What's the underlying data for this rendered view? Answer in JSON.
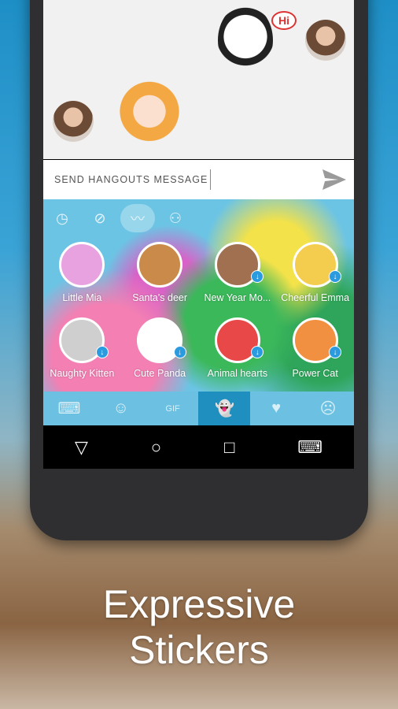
{
  "chat": {
    "input_placeholder": "SEND HANGOUTS MESSAGE",
    "sticker_bubble": "Hi"
  },
  "keyboard": {
    "categories": [
      {
        "icon": "clock-icon"
      },
      {
        "icon": "compass-icon"
      },
      {
        "icon": "trending-icon",
        "active": true
      },
      {
        "icon": "person-icon"
      }
    ],
    "stickers": [
      {
        "label": "Little Mia",
        "color": "#e9a2e0",
        "download": false
      },
      {
        "label": "Santa's deer",
        "color": "#c98a4a",
        "download": false
      },
      {
        "label": "New Year Mo...",
        "color": "#a07050",
        "download": true
      },
      {
        "label": "Cheerful Emma",
        "color": "#f5cd4e",
        "download": true
      },
      {
        "label": "Naughty Kitten",
        "color": "#cfcfcf",
        "download": true
      },
      {
        "label": "Cute Panda",
        "color": "#ffffff",
        "download": true
      },
      {
        "label": "Animal hearts",
        "color": "#e84848",
        "download": true
      },
      {
        "label": "Power Cat",
        "color": "#f09040",
        "download": true
      }
    ],
    "tabs": [
      {
        "icon": "keyboard-icon",
        "glyph": "⌨"
      },
      {
        "icon": "emoji-icon",
        "glyph": "☺"
      },
      {
        "icon": "gif-icon",
        "glyph": "GIF"
      },
      {
        "icon": "sticker-ghost-icon",
        "glyph": "👻",
        "active": true
      },
      {
        "icon": "heart-icon",
        "glyph": "♥"
      },
      {
        "icon": "emoticon-icon",
        "glyph": "☹"
      }
    ]
  },
  "nav": {
    "back": "▽",
    "home": "○",
    "recents": "□",
    "keyboard": "⌨"
  },
  "headline": {
    "line1": "Expressive",
    "line2": "Stickers"
  }
}
